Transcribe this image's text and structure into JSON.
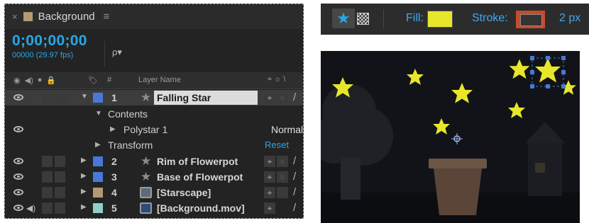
{
  "timeline": {
    "close_glyph": "×",
    "title": "Background",
    "menu_glyph": "≡",
    "timecode": "0;00;00;00",
    "fps": "00000 (29.97 fps)",
    "search_placeholder": "ρ▾",
    "header": {
      "icons": "◉ ◀) ● 🔒",
      "label_icon": "🏷",
      "num": "#",
      "layer_name": "Layer Name",
      "switches": "⌖ ☼ \\"
    },
    "layers": [
      {
        "num": "1",
        "name": "Falling Star",
        "color": "#4a78d8",
        "icon": "star-icon",
        "selected": true
      },
      {
        "num": "2",
        "name": "Rim of Flowerpot",
        "color": "#4a78d8",
        "icon": "star-icon"
      },
      {
        "num": "3",
        "name": "Base of Flowerpot",
        "color": "#4a78d8",
        "icon": "star-icon"
      },
      {
        "num": "4",
        "name": "[Starscape]",
        "color": "#b39a72",
        "icon": "composition-icon"
      },
      {
        "num": "5",
        "name": "[Background.mov]",
        "color": "#8fd1c9",
        "icon": "footage-icon"
      }
    ],
    "contents_label": "Contents",
    "polystar_label": "Polystar 1",
    "blend_mode": "Normal",
    "transform_label": "Transform",
    "reset_label": "Reset"
  },
  "toolbar": {
    "fill_label": "Fill:",
    "fill_color": "#e8e62b",
    "stroke_label": "Stroke:",
    "stroke_color": "#c64b2b",
    "stroke_width": "2 px"
  }
}
